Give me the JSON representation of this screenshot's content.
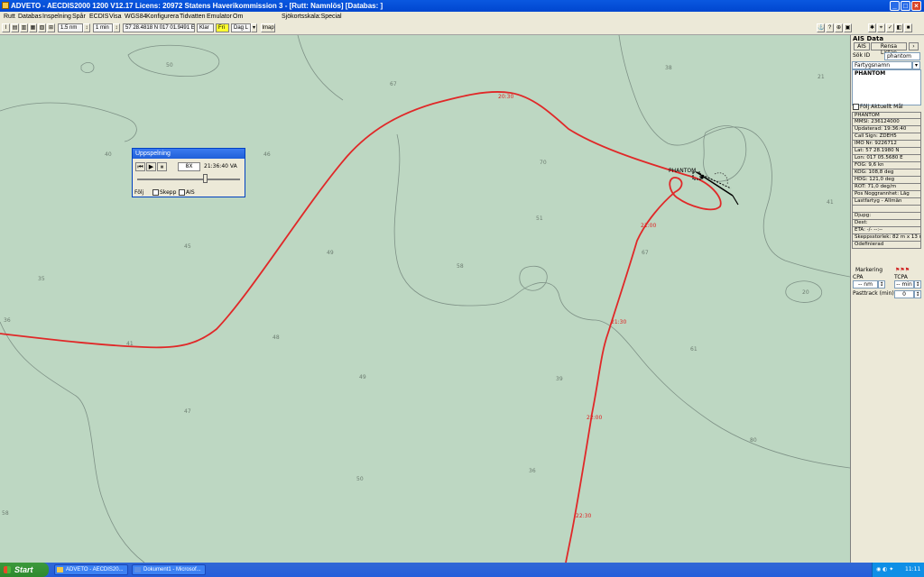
{
  "window": {
    "title": "ADVETO - AECDIS2000 1200 V12.17  Licens: 20972 Statens Haverikommission 3 - [Rutt: Namnlös] [Databas: ]"
  },
  "menu": [
    "Rutt",
    "Databas",
    "Inspelning",
    "Spår",
    "ECDIS",
    "Visa",
    "WGS84",
    "Konfigurera",
    "Tidvatten",
    "Emulator",
    "Om"
  ],
  "menu_status": "Sjökortsskala:Special",
  "toolbar": {
    "scale": "1.5 nm",
    "interval": "1 min",
    "position": "57 28.4818 N  017 01.9491 E",
    "mode": "Klar",
    "fri": "Fri",
    "day": "Dag L",
    "imap": "Imap"
  },
  "map": {
    "depths": [
      "50",
      "67",
      "38",
      "21",
      "40",
      "46",
      "70",
      "41",
      "45",
      "49",
      "51",
      "67",
      "35",
      "58",
      "20",
      "36",
      "41",
      "48",
      "61",
      "49",
      "39",
      "47",
      "50",
      "36",
      "80",
      "58"
    ],
    "time_labels": [
      "20:30",
      "21:00",
      "21:30",
      "22:00",
      "22:30"
    ],
    "vessel_label": "PHANTOM"
  },
  "playback": {
    "title": "Uppspelning",
    "speed": "8X",
    "time": "21:36:40",
    "time_suffix": "VA",
    "follow": "Följ",
    "ship": "Skepp",
    "ais": "AIS"
  },
  "ais_panel": {
    "title": "AIS Data",
    "tab_ais": "AIS",
    "tab_clear": "Rensa Listan",
    "search_label": "Sök ID",
    "search_value": "phantom",
    "category": "Fartygsnamn",
    "list": [
      "PHANTOM"
    ],
    "follow_label": "Följ Aktuellt Mål",
    "info": [
      "PHANTOM",
      "MMSI: 236124000",
      "Updaterad: 19:36:40",
      "Call Sign: ZDEH5",
      "IMO Nr: 9226712",
      "Lat: 57 28.1980 N",
      "Lon: 017 05.5680 E",
      "FOG: 9,6 kn",
      "KÖG: 108,8 deg",
      "HDG: 121,0 deg",
      "ROT: 71,0 deg/m",
      "Pos Noggrannhet: Låg",
      "Lastfartyg - Allmän",
      "",
      "Djupg:",
      "Dest:",
      "ETA: -/- --:--",
      "Skeppsstorlek: 82 m x 13 m",
      "Odefinierad"
    ],
    "marking_label": "Markering",
    "cpa_label": "CPA",
    "tcpa_label": "TCPA",
    "cpa_value": "-- nm",
    "tcpa_value": "-- min",
    "pasttrack_label": "Pasttrack (min)",
    "pasttrack_value": "0"
  },
  "taskbar": {
    "start": "Start",
    "tasks": [
      "ADVETO - AECDIS20...",
      "Dokument1 - Microsof..."
    ],
    "clock": "11:11"
  }
}
